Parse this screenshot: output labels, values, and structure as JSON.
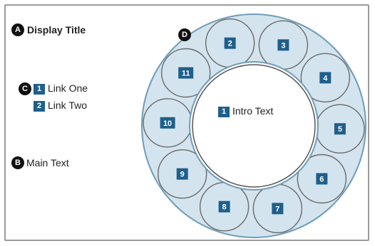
{
  "markers": {
    "a": "A",
    "b": "B",
    "c": "C",
    "d": "D"
  },
  "display_title": "Display Title",
  "main_text": "Main Text",
  "links": [
    {
      "num": "1",
      "label": "Link One"
    },
    {
      "num": "2",
      "label": "Link Two"
    }
  ],
  "intro": {
    "num": "1",
    "label": "Intro Text"
  },
  "ring_items": [
    "2",
    "3",
    "4",
    "5",
    "6",
    "7",
    "8",
    "9",
    "10",
    "11"
  ],
  "colors": {
    "ring_fill": "#d4e4ee",
    "ring_stroke": "#6e9cba",
    "badge": "#1f5f8b",
    "marker": "#111111",
    "frame": "#9a9a9a"
  }
}
